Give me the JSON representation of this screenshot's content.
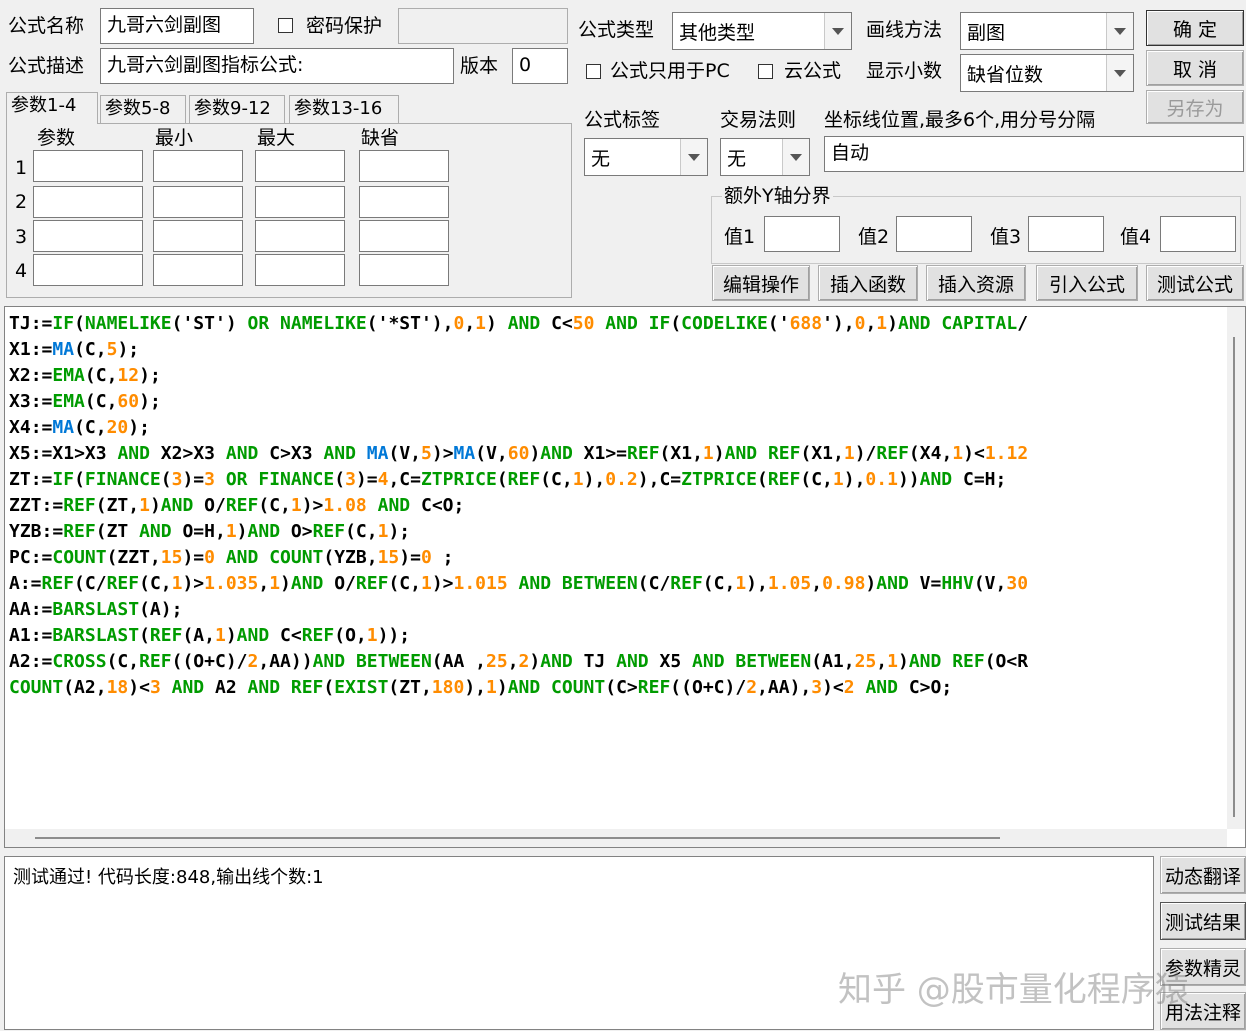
{
  "form": {
    "name_label": "公式名称",
    "name_value": "九哥六剑副图",
    "password_label": "密码保护",
    "desc_label": "公式描述",
    "desc_value": "九哥六剑副图指标公式:",
    "version_label": "版本",
    "version_value": "0",
    "type_label": "公式类型",
    "type_value": "其他类型",
    "draw_label": "画线方法",
    "draw_value": "副图",
    "pc_only_label": "公式只用于PC",
    "cloud_label": "云公式",
    "decimals_label": "显示小数",
    "decimals_value": "缺省位数",
    "tag_label": "公式标签",
    "tag_value": "无",
    "trade_label": "交易法则",
    "trade_value": "无",
    "axis_label": "坐标线位置,最多6个,用分号分隔",
    "axis_value": "自动",
    "extra_y_label": "额外Y轴分界",
    "val1_label": "值1",
    "val2_label": "值2",
    "val3_label": "值3",
    "val4_label": "值4"
  },
  "buttons": {
    "ok": "确 定",
    "cancel": "取 消",
    "save_as": "另存为",
    "edit": "编辑操作",
    "insert_func": "插入函数",
    "insert_res": "插入资源",
    "import": "引入公式",
    "test": "测试公式"
  },
  "tabs": [
    "参数1-4",
    "参数5-8",
    "参数9-12",
    "参数13-16"
  ],
  "params": {
    "headers": [
      "参数",
      "最小",
      "最大",
      "缺省"
    ],
    "rows": [
      "1",
      "2",
      "3",
      "4"
    ]
  },
  "code_lines": [
    "TJ:=IF(NAMELIKE('ST') OR NAMELIKE('*ST'),0,1) AND C<50 AND IF(CODELIKE('688'),0,1)AND CAPITAL/",
    "X1:=MA(C,5);",
    "X2:=EMA(C,12);",
    "X3:=EMA(C,60);",
    "X4:=MA(C,20);",
    "X5:=X1>X3 AND X2>X3 AND C>X3 AND MA(V,5)>MA(V,60)AND X1>=REF(X1,1)AND REF(X1,1)/REF(X4,1)<1.12",
    "ZT:=IF(FINANCE(3)=3 OR FINANCE(3)=4,C=ZTPRICE(REF(C,1),0.2),C=ZTPRICE(REF(C,1),0.1))AND C=H;",
    "ZZT:=REF(ZT,1)AND O/REF(C,1)>1.08 AND C<O;",
    "YZB:=REF(ZT AND O=H,1)AND O>REF(C,1);",
    "PC:=COUNT(ZZT,15)=0 AND COUNT(YZB,15)=0 ;",
    "A:=REF(C/REF(C,1)>1.035,1)AND O/REF(C,1)>1.015 AND BETWEEN(C/REF(C,1),1.05,0.98)AND V=HHV(V,30",
    "AA:=BARSLAST(A);",
    "A1:=BARSLAST(REF(A,1)AND C<REF(O,1));",
    "A2:=CROSS(C,REF((O+C)/2,AA))AND BETWEEN(AA ,25,2)AND TJ AND X5 AND BETWEEN(A1,25,1)AND REF(O<R",
    "COUNT(A2,18)<3 AND A2 AND REF(EXIST(ZT,180),1)AND COUNT(C>REF((O+C)/2,AA),3)<2 AND C>O;"
  ],
  "status": {
    "message": "测试通过! 代码长度:848,输出线个数:1"
  },
  "side_buttons": [
    "动态翻译",
    "测试结果",
    "参数精灵",
    "用法注释"
  ],
  "watermark": "知乎 @股市量化程序猿",
  "colors": {
    "keyword": "#009b00",
    "number": "#ff8c00",
    "ma_func": "#0078d7"
  }
}
